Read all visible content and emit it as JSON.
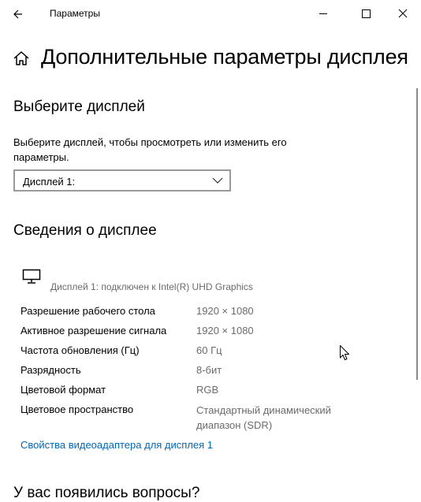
{
  "window": {
    "app_title": "Параметры",
    "buttons": [
      "back",
      "minimize",
      "maximize",
      "close"
    ]
  },
  "page": {
    "title": "Дополнительные параметры дисплея"
  },
  "select_display": {
    "heading": "Выберите дисплей",
    "description": "Выберите дисплей, чтобы просмотреть или изменить его параметры.",
    "dropdown_value": "Дисплей 1:"
  },
  "display_info": {
    "heading": "Сведения о дисплее",
    "connected": "Дисплей 1: подключен к Intel(R) UHD Graphics",
    "properties": [
      {
        "label": "Разрешение рабочего стола",
        "value": "1920 × 1080"
      },
      {
        "label": "Активное разрешение сигнала",
        "value": "1920 × 1080"
      },
      {
        "label": "Частота обновления (Гц)",
        "value": "60 Гц"
      },
      {
        "label": "Разрядность",
        "value": "8-бит"
      },
      {
        "label": "Цветовой формат",
        "value": "RGB"
      },
      {
        "label": "Цветовое пространство",
        "value": "Стандартный динамический диапазон (SDR)"
      }
    ],
    "adapter_link": "Свойства видеоадаптера для дисплея 1"
  },
  "questions": {
    "heading": "У вас появились вопросы?"
  },
  "colors": {
    "link": "#0067b8",
    "secondary_text": "#6b6b6b",
    "dropdown_border": "#999999"
  },
  "icons": [
    "back-arrow-icon",
    "minimize-icon",
    "maximize-icon",
    "close-icon",
    "home-icon",
    "chevron-down-icon",
    "monitor-icon",
    "mouse-cursor-icon"
  ]
}
